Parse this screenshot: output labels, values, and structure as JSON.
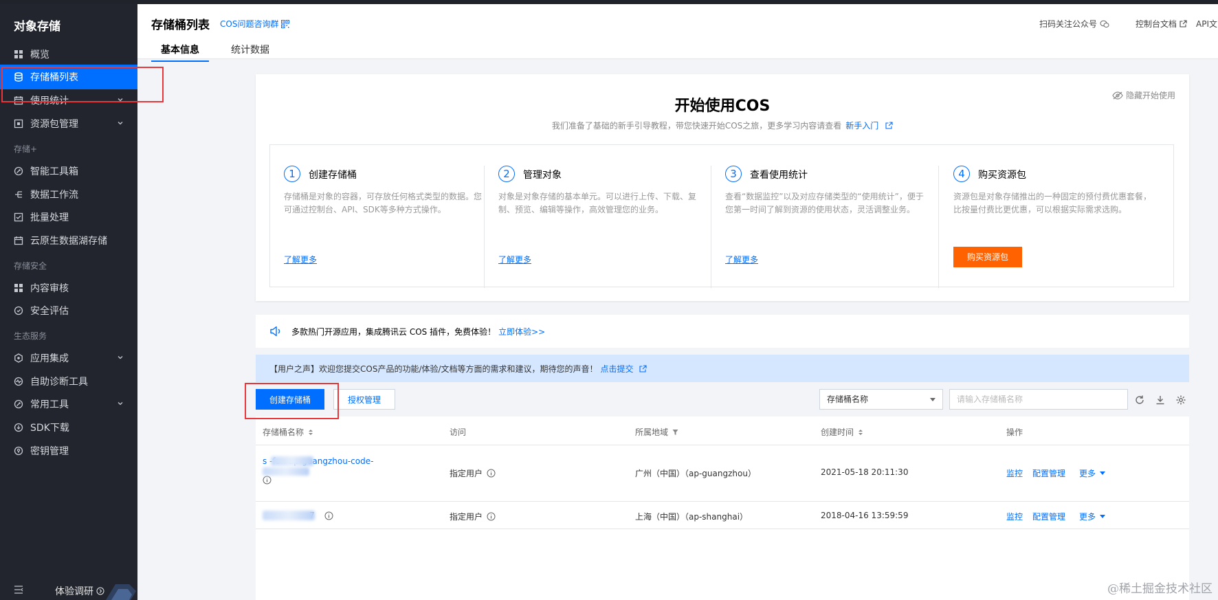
{
  "sidebar": {
    "title": "对象存储",
    "items": [
      {
        "label": "概览"
      },
      {
        "label": "存储桶列表"
      },
      {
        "label": "使用统计"
      },
      {
        "label": "资源包管理"
      },
      {
        "label": "智能工具箱"
      },
      {
        "label": "数据工作流"
      },
      {
        "label": "批量处理"
      },
      {
        "label": "云原生数据湖存储"
      },
      {
        "label": "内容审核"
      },
      {
        "label": "安全评估"
      },
      {
        "label": "应用集成"
      },
      {
        "label": "自助诊断工具"
      },
      {
        "label": "常用工具"
      },
      {
        "label": "SDK下载"
      },
      {
        "label": "密钥管理"
      }
    ],
    "groups": [
      "存储+",
      "存储安全",
      "生态服务"
    ],
    "survey_label": "体验调研"
  },
  "header": {
    "title": "存储桶列表",
    "group_link": "COS问题咨询群",
    "right_links": [
      "扫码关注公众号",
      "控制台文档",
      "API文"
    ],
    "tabs": [
      "基本信息",
      "统计数据"
    ]
  },
  "start": {
    "title": "开始使用COS",
    "hide_label": "隐藏开始使用",
    "desc": "我们准备了基础的新手引导教程，带您快速开始COS之旅，更多学习内容请查看",
    "desc_link": "新手入门",
    "steps": [
      {
        "num": "1",
        "title": "创建存储桶",
        "desc": "存储桶是对象的容器，可存放任何格式类型的数据。您可通过控制台、API、SDK等多种方式操作。",
        "link": "了解更多"
      },
      {
        "num": "2",
        "title": "管理对象",
        "desc": "对象是对象存储的基本单元。可以进行上传、下载、复制、预览、编辑等操作，高效管理您的业务。",
        "link": "了解更多"
      },
      {
        "num": "3",
        "title": "查看使用统计",
        "desc": "查看“数据监控”以及对应存储类型的“使用统计”，便于您第一时间了解到资源的使用状态，灵活调整业务。",
        "link": "了解更多"
      },
      {
        "num": "4",
        "title": "购买资源包",
        "desc": "资源包是对象存储推出的一种固定的预付费优惠套餐，比按量付费比更优惠，可以根据实际需求选购。",
        "button": "购买资源包"
      }
    ]
  },
  "promo": {
    "text": "多款热门开源应用，集成腾讯云 COS 插件，免费体验！",
    "link": "立即体验>>"
  },
  "voice": {
    "text": "【用户之声】欢迎您提交COS产品的功能/体验/文档等方面的需求和建议，期待您的声音！",
    "link": "点击提交"
  },
  "toolbar": {
    "create_label": "创建存储桶",
    "auth_label": "授权管理",
    "select_value": "存储桶名称",
    "search_placeholder": "请输入存储桶名称"
  },
  "table": {
    "headers": [
      "存储桶名称",
      "访问",
      "所属地域",
      "创建时间",
      "操作"
    ],
    "rows": [
      {
        "name": "s          -fon-ap-guangzhou-code-",
        "access": "指定用户",
        "region": "广州（中国）（ap-guangzhou）",
        "created": "2021-05-18 20:11:30",
        "op1": "监控",
        "op2": "配置管理",
        "op3": "更多"
      },
      {
        "name": "7",
        "access": "指定用户",
        "region": "上海（中国）（ap-shanghai）",
        "created": "2018-04-16 13:59:59",
        "op1": "监控",
        "op2": "配置管理",
        "op3": "更多"
      }
    ]
  },
  "watermark": "@稀土掘金技术社区",
  "colors": {
    "accent": "#006eff",
    "sidebar_bg": "#22252e",
    "orange": "#ff6200",
    "highlight_box": "#e8363a"
  }
}
